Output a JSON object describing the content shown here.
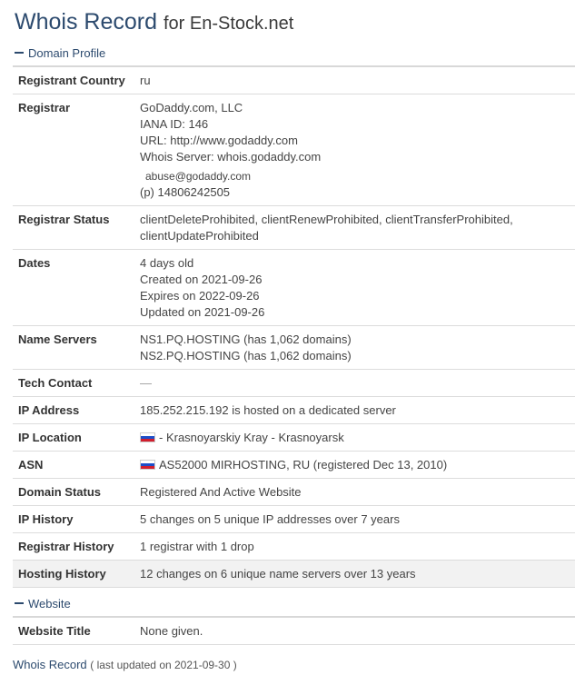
{
  "header": {
    "title_main": "Whois Record",
    "title_for": "for En-Stock.net"
  },
  "sections": {
    "domain_profile": "Domain Profile",
    "website": "Website"
  },
  "profile": {
    "registrant_country": {
      "label": "Registrant Country",
      "value": "ru"
    },
    "registrar": {
      "label": "Registrar",
      "name": "GoDaddy.com, LLC",
      "iana": "IANA ID: 146",
      "url": "URL: http://www.godaddy.com",
      "whois_server": "Whois Server: whois.godaddy.com",
      "email": "abuse@godaddy.com",
      "phone": "(p)  14806242505"
    },
    "registrar_status": {
      "label": "Registrar Status",
      "line1": "clientDeleteProhibited, clientRenewProhibited, clientTransferProhibited,",
      "line2": "clientUpdateProhibited"
    },
    "dates": {
      "label": "Dates",
      "age": "4 days old",
      "created": "Created on 2021-09-26",
      "expires": "Expires on 2022-09-26",
      "updated": "Updated on 2021-09-26"
    },
    "name_servers": {
      "label": "Name Servers",
      "ns1": "NS1.PQ.HOSTING (has 1,062 domains)",
      "ns2": "NS2.PQ.HOSTING (has 1,062 domains)"
    },
    "tech_contact": {
      "label": "Tech Contact",
      "value": "—"
    },
    "ip_address": {
      "label": "IP Address",
      "value": "185.252.215.192 is hosted on a dedicated server"
    },
    "ip_location": {
      "label": "IP Location",
      "value": "- Krasnoyarskiy Kray - Krasnoyarsk"
    },
    "asn": {
      "label": "ASN",
      "value": "AS52000 MIRHOSTING, RU (registered Dec 13, 2010)"
    },
    "domain_status": {
      "label": "Domain Status",
      "value": "Registered And Active Website"
    },
    "ip_history": {
      "label": "IP History",
      "value": "5 changes on 5 unique IP addresses over 7 years"
    },
    "registrar_history": {
      "label": "Registrar History",
      "value": "1 registrar with 1 drop"
    },
    "hosting_history": {
      "label": "Hosting History",
      "value": "12 changes on 6 unique name servers over 13 years"
    }
  },
  "website": {
    "title": {
      "label": "Website Title",
      "value": "None given."
    }
  },
  "footer": {
    "link": "Whois Record",
    "updated": "( last updated on 2021-09-30 )"
  },
  "icons": {
    "flag": "russia-flag-icon",
    "collapse": "minus-icon"
  },
  "colors": {
    "accent": "#2c4a6e",
    "shaded_row": "#f2f2f2"
  }
}
